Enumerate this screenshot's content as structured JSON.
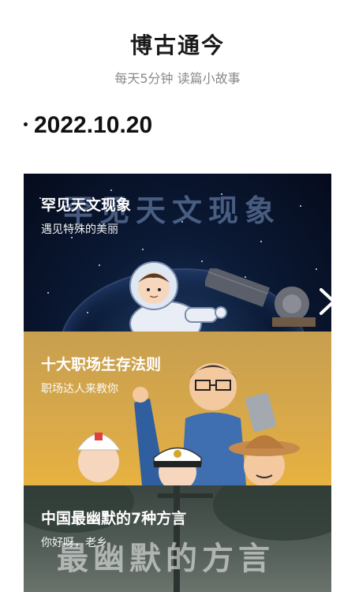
{
  "header": {
    "title": "博古通今",
    "subtitle": "每天5分钟 读篇小故事"
  },
  "date": "2022.10.20",
  "cards": [
    {
      "title": "罕见天文现象",
      "subtitle": "遇见特殊的美丽",
      "watermark": "罕见天文现象",
      "theme": "#0b1a36"
    },
    {
      "title": "十大职场生存法则",
      "subtitle": "职场达人来教你",
      "theme": "#d9a94a"
    },
    {
      "title": "中国最幽默的7种方言",
      "subtitle": "你好呀，老乡",
      "watermark": "最幽默的方言",
      "theme": "#4f5a54"
    }
  ],
  "icons": {
    "next": "chevron-right-icon"
  }
}
